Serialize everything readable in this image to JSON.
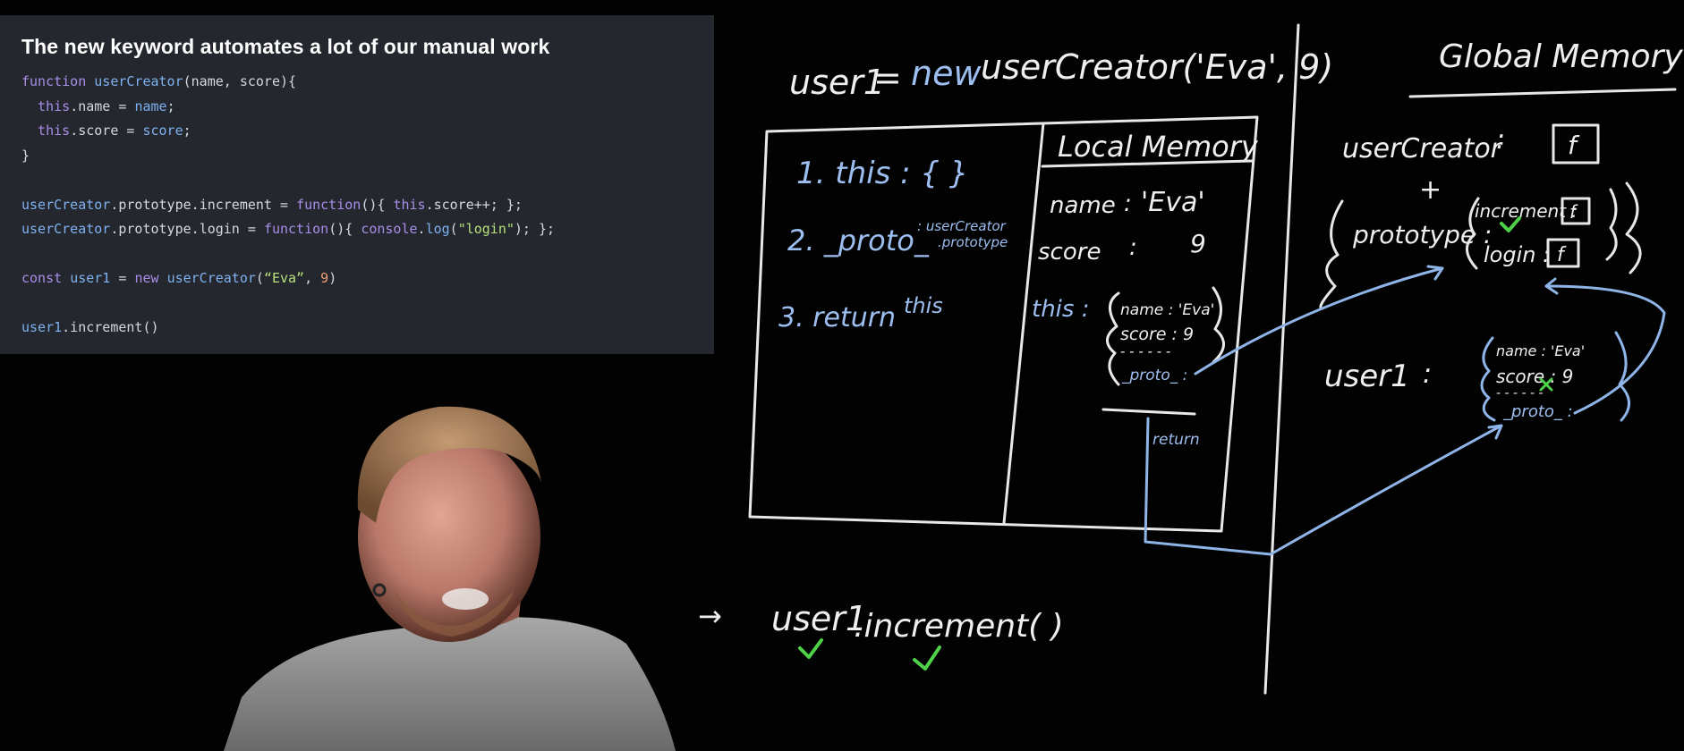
{
  "slide": {
    "title": "The new keyword automates a lot of our manual work",
    "code": {
      "l1": {
        "a": "function",
        "b": " ",
        "c": "userCreator",
        "d": "(name, score){"
      },
      "l2": {
        "a": "  this",
        "b": ".name = ",
        "c": "name",
        "d": ";"
      },
      "l3": {
        "a": "  this",
        "b": ".score = ",
        "c": "score",
        "d": ";"
      },
      "l4": {
        "a": "}"
      },
      "l6": {
        "a": "userCreator",
        "b": ".prototype.",
        "c": "increment",
        "d": " = ",
        "e": "function",
        "f": "(){ ",
        "g": "this",
        "h": ".score++; };"
      },
      "l7": {
        "a": "userCreator",
        "b": ".prototype.",
        "c": "login",
        "d": " = ",
        "e": "function",
        "f": "(){ ",
        "g": "console",
        "h": ".",
        "i": "log",
        "j": "(",
        "k": "\"login\"",
        "l": "); };"
      },
      "l9": {
        "a": "const",
        "b": " ",
        "c": "user1",
        "d": " = ",
        "e": "new",
        "f": " ",
        "g": "userCreator",
        "h": "(",
        "i": "“Eva”",
        "j": ", ",
        "k": "9",
        "l": ")"
      },
      "l11": {
        "a": "user1",
        "b": ".increment()"
      }
    }
  },
  "board": {
    "call_line": {
      "lhs": "user1",
      "eq": "=",
      "kw": "new",
      "rhs": "userCreator('Eva', 9)"
    },
    "steps": {
      "s1": "1. this : {     }",
      "s2": "2. _proto_",
      "s2_note_a": ": userCreator",
      "s2_note_b": ".prototype",
      "s3": "3. return",
      "s3_this": "this"
    },
    "local_memory": {
      "title": "Local Memory",
      "name_key": "name",
      "name_sep": ":",
      "name_val": "'Eva'",
      "score_key": "score",
      "score_sep": ":",
      "score_val": "9",
      "this_key": "this :",
      "obj_name": "name : 'Eva'",
      "obj_score": "score : 9",
      "obj_dashes": "- - - - - -",
      "obj_proto": "_proto_ :",
      "return_label": "return"
    },
    "global_memory": {
      "title": "Global Memory",
      "creator_key": "userCreator",
      "creator_sep": ":",
      "creator_fn": "f",
      "plus": "+",
      "prototype_key": "prototype :",
      "increment_key": "increment :",
      "increment_fn": "f",
      "login_key": "login :",
      "login_fn": "f",
      "user_key": "user1",
      "user_sep": ":",
      "obj_name": "name : 'Eva'",
      "obj_score": "score : 9",
      "obj_dashes": "- - - - - -",
      "obj_proto": "_proto_ :"
    },
    "bottom_call": {
      "arrow": "→",
      "obj": "user1",
      "method": ".increment( )"
    }
  },
  "colors": {
    "panel": "#24272e",
    "chalk": "#e8e8e8",
    "chalk_blue": "#8fb4e8",
    "tick": "#4fd24a"
  }
}
